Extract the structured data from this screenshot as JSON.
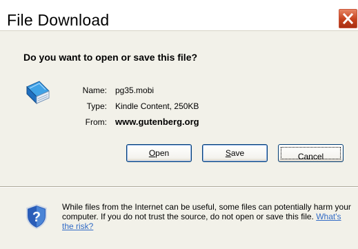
{
  "window": {
    "title": "File Download",
    "close_icon": "close-icon"
  },
  "dialog": {
    "question": "Do you want to open or save this file?",
    "file_icon": "kindle-book-icon",
    "name_label": "Name:",
    "name_value": "pg35.mobi",
    "type_label": "Type:",
    "type_value": "Kindle Content, 250KB",
    "from_label": "From:",
    "from_value": "www.gutenberg.org"
  },
  "buttons": {
    "open": {
      "mnemonic": "O",
      "rest": "pen"
    },
    "save": {
      "mnemonic": "S",
      "rest": "ave"
    },
    "cancel": {
      "label": "Cancel"
    }
  },
  "footer": {
    "shield_icon": "security-shield-icon",
    "warning_text": "While files from the Internet can be useful, some files can potentially harm your computer. If you do not trust the source, do not open or save this file.",
    "risk_link": "What's the risk?"
  },
  "colors": {
    "dialog_bg": "#ece9d8",
    "close_button": "#c4401b",
    "button_border": "#003c74",
    "link": "#316ac5"
  }
}
